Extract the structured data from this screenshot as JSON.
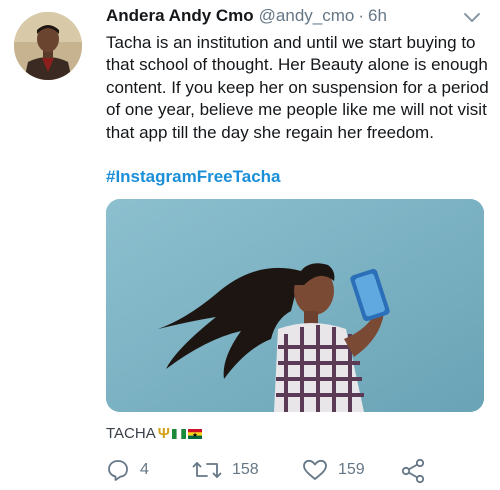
{
  "tweet": {
    "author_name": "Andera Andy Cmo",
    "handle": "@andy_cmo",
    "separator": "·",
    "time": "6h",
    "text": "Tacha is an institution and until we start buying to that school of thought. Her Beauty alone is enough content. If you keep her on suspension for a period of one year, believe me people like me will not visit that app till the day she regain her freedom.",
    "hashtag": "#InstagramFreeTacha",
    "media_footer": "TACHA",
    "media_footer_icons": [
      "trident-emoji",
      "nigeria-flag-emoji",
      "ghana-flag-emoji"
    ]
  },
  "actions": {
    "reply_count": "4",
    "retweet_count": "158",
    "like_count": "159"
  },
  "icons": {
    "caret": "chevron-down-icon",
    "reply": "reply-icon",
    "retweet": "retweet-icon",
    "like": "heart-icon",
    "share": "share-icon"
  },
  "colors": {
    "hashtag": "#1b8fd8",
    "muted": "#657786",
    "media_background": "#7fb5c6"
  }
}
